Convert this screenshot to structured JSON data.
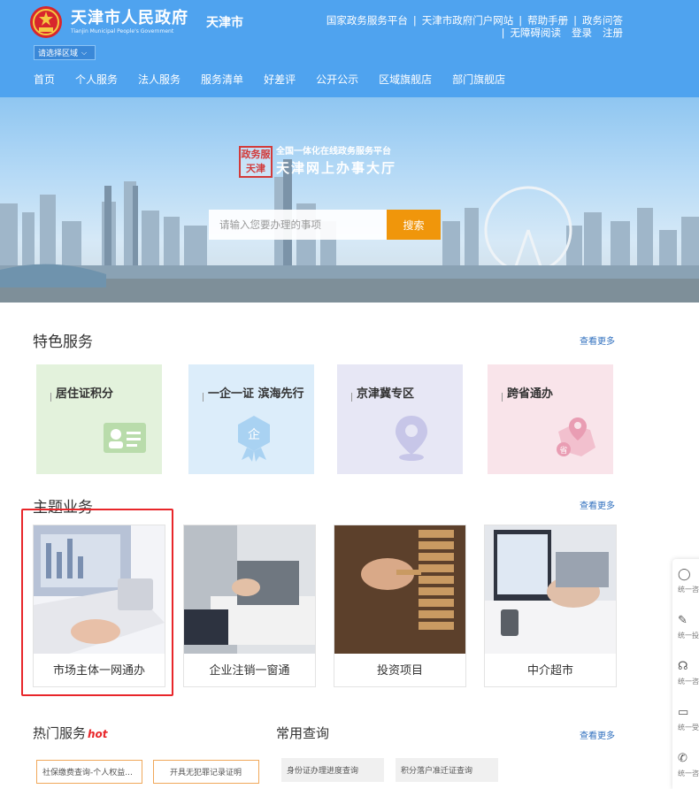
{
  "header": {
    "gov_name": "天津市人民政府",
    "gov_name_en": "Tianjin Municipal People's Government",
    "city": "天津市",
    "region_select": "请选择区域",
    "top_links_row1": [
      "国家政务服务平台",
      "天津市政府门户网站",
      "帮助手册",
      "政务问答"
    ],
    "top_links_row2": [
      "无障碍阅读",
      "登录",
      "注册"
    ],
    "nav": [
      "首页",
      "个人服务",
      "法人服务",
      "服务清单",
      "好差评",
      "公开公示",
      "区域旗舰店",
      "部门旗舰店"
    ]
  },
  "banner": {
    "seal": "政务服天津",
    "subtitle": "全国一体化在线政务服务平台",
    "title": "天津网上办事大厅",
    "search_placeholder": "请输入您要办理的事项",
    "search_button": "搜索"
  },
  "featured": {
    "title": "特色服务",
    "more": "查看更多",
    "tiles": [
      {
        "label": "居住证积分",
        "bg": "#e3f2dc",
        "icon": "id-card-icon"
      },
      {
        "label": "一企一证 滨海先行",
        "bg": "#dcedfa",
        "icon": "badge-icon"
      },
      {
        "label": "京津冀专区",
        "bg": "#e7e7f5",
        "icon": "location-pin-icon"
      },
      {
        "label": "跨省通办",
        "bg": "#f9e4ea",
        "icon": "province-map-icon"
      }
    ]
  },
  "topics": {
    "title": "主题业务",
    "more": "查看更多",
    "items": [
      {
        "label": "市场主体一网通办"
      },
      {
        "label": "企业注销一窗通"
      },
      {
        "label": "投资项目"
      },
      {
        "label": "中介超市"
      }
    ]
  },
  "hot": {
    "title": "热门服务",
    "badge": "hot",
    "chips": [
      "社保缴费查询-个人权益...",
      "开具无犯罪记录证明"
    ]
  },
  "common": {
    "title": "常用查询",
    "more": "查看更多",
    "chips": [
      "身份证办理进度查询",
      "积分落户准迁证查询"
    ]
  },
  "side": {
    "items": [
      "统一咨",
      "统一投",
      "统一咨",
      "统一受",
      "统一咨"
    ]
  }
}
